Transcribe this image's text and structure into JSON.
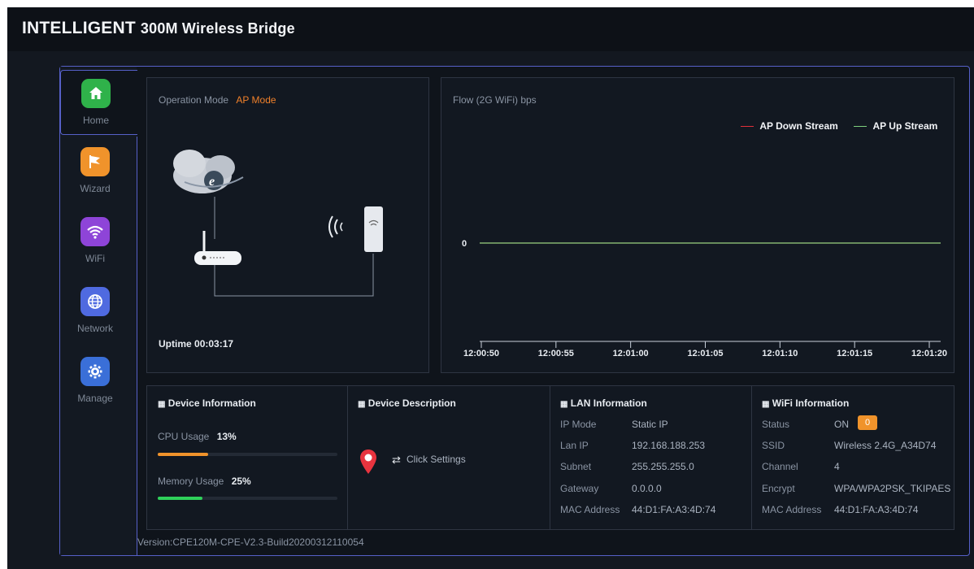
{
  "header": {
    "title_bold": "INTELLIGENT",
    "title_rest": "300M Wireless Bridge"
  },
  "nav": [
    {
      "label": "Home",
      "icon": "home-icon",
      "color": "#2fb24a"
    },
    {
      "label": "Wizard",
      "icon": "flag-icon",
      "color": "#f0932b"
    },
    {
      "label": "WiFi",
      "icon": "wifi-icon",
      "color": "#8e44d8"
    },
    {
      "label": "Network",
      "icon": "globe-icon",
      "color": "#4f6ae0"
    },
    {
      "label": "Manage",
      "icon": "gear-icon",
      "color": "#3a6fd8"
    }
  ],
  "mode": {
    "label": "Operation Mode",
    "value": "AP Mode",
    "uptime_label": "Uptime",
    "uptime": "00:03:17"
  },
  "flow": {
    "title": "Flow (2G WiFi) bps",
    "legend_down": "AP Down Stream",
    "legend_up": "AP Up Stream",
    "down_color": "#e0303a",
    "up_color": "#7ed07e"
  },
  "chart_data": {
    "type": "line",
    "title": "Flow (2G WiFi) bps",
    "x": [
      "12:00:50",
      "12:00:55",
      "12:01:00",
      "12:01:05",
      "12:01:10",
      "12:01:15",
      "12:01:20"
    ],
    "series": [
      {
        "name": "AP Down Stream",
        "values": [
          0,
          0,
          0,
          0,
          0,
          0,
          0
        ]
      },
      {
        "name": "AP Up Stream",
        "values": [
          0,
          0,
          0,
          0,
          0,
          0,
          0
        ]
      }
    ],
    "yticks": [
      "0"
    ],
    "legend": "top-right"
  },
  "device": {
    "title": "Device Information",
    "cpu_label": "CPU Usage",
    "cpu_value": "13%",
    "cpu_fraction": 0.13,
    "mem_label": "Memory Usage",
    "mem_value": "25%",
    "mem_fraction": 0.25,
    "cpu_color": "#f0932b",
    "mem_color": "#2fd15a"
  },
  "desc": {
    "title": "Device Description",
    "action": "Click Settings"
  },
  "lan": {
    "title": "LAN Information",
    "rows": [
      {
        "k": "IP Mode",
        "v": "Static IP"
      },
      {
        "k": "Lan IP",
        "v": "192.168.188.253"
      },
      {
        "k": "Subnet",
        "v": "255.255.255.0"
      },
      {
        "k": "Gateway",
        "v": "0.0.0.0"
      },
      {
        "k": "MAC Address",
        "v": "44:D1:FA:A3:4D:74"
      }
    ]
  },
  "wifi": {
    "title": "WiFi Information",
    "status_label": "Status",
    "status_value": "ON",
    "clients": "0",
    "rows": [
      {
        "k": "SSID",
        "v": "Wireless 2.4G_A34D74"
      },
      {
        "k": "Channel",
        "v": "4"
      },
      {
        "k": "Encrypt",
        "v": "WPA/WPA2PSK_TKIPAES"
      },
      {
        "k": "MAC Address",
        "v": "44:D1:FA:A3:4D:74"
      }
    ]
  },
  "version": "Version:CPE120M-CPE-V2.3-Build20200312110054"
}
